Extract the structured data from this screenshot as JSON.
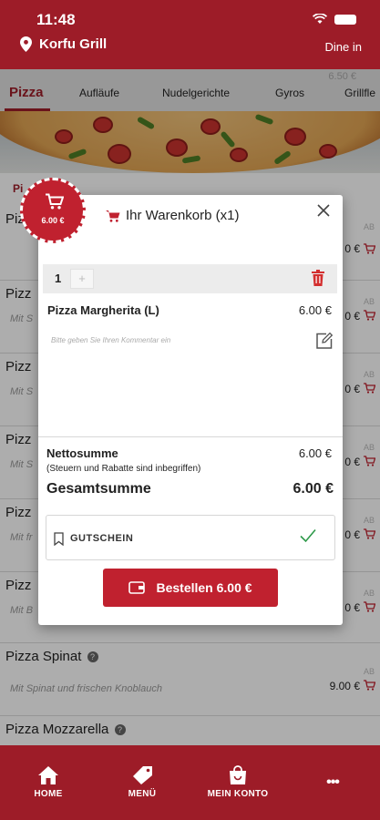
{
  "status_bar": {
    "time": "11:48"
  },
  "header": {
    "restaurant": "Korfu Grill",
    "mode": "Dine in"
  },
  "tabs": {
    "active": "Pizza",
    "items": [
      "Aufläufe",
      "Nudelgerichte",
      "Gyros",
      "Grillfle"
    ],
    "ghost_price": "6.50 €"
  },
  "menu": {
    "section_ghost": "Pi",
    "items": [
      {
        "title": "Pizz",
        "desc": "",
        "price": "0 €",
        "ab": "AB"
      },
      {
        "title": "Pizz",
        "desc": "Mit S",
        "price": "0 €",
        "ab": "AB"
      },
      {
        "title": "Pizz",
        "desc": "Mit S",
        "price": "0 €",
        "ab": "AB"
      },
      {
        "title": "Pizz",
        "desc": "Mit S",
        "price": "0 €",
        "ab": "AB"
      },
      {
        "title": "Pizz",
        "desc": "Mit fr",
        "price": "0 €",
        "ab": "AB"
      },
      {
        "title": "Pizz",
        "desc": "Mit B",
        "price": "0 €",
        "ab": "AB"
      },
      {
        "title": "Pizza Spinat",
        "desc": "Mit Spinat und frischen Knoblauch",
        "price": "9.00 €",
        "ab": "AB"
      },
      {
        "title": "Pizza Mozzarella",
        "desc": "",
        "price": "",
        "ab": ""
      }
    ]
  },
  "cart_badge": {
    "total": "6.00 €"
  },
  "cart_modal": {
    "title": "Ihr Warenkorb (x1)",
    "quantity": "1",
    "plus": "+",
    "item_name": "Pizza Margherita (L)",
    "item_price": "6.00 €",
    "comment_placeholder": "Bitte geben Sie Ihren Kommentar ein",
    "net_label": "Nettosumme",
    "net_value": "6.00 €",
    "tax_note": "(Steuern und Rabatte sind inbegriffen)",
    "gross_label": "Gesamtsumme",
    "gross_value": "6.00 €",
    "voucher_label": "GUTSCHEIN",
    "order_button": "Bestellen 6.00 €"
  },
  "bottom_nav": {
    "home": "HOME",
    "menu": "MENÜ",
    "account": "MEIN KONTO",
    "more": "•••"
  },
  "colors": {
    "brand": "#9d1c28",
    "accent": "#c0212f",
    "check": "#2e9a4a"
  }
}
